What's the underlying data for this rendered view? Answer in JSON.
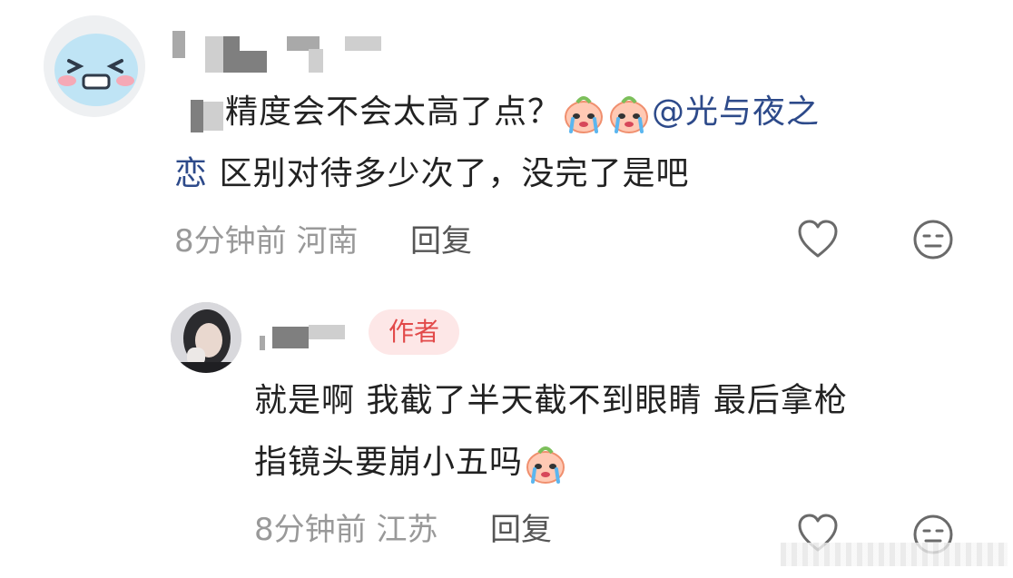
{
  "comment": {
    "text_line1_part1": "精度会不会太高了点？",
    "mention": "@光与夜之",
    "mention_cont": "恋",
    "text_line2": " 区别对待多少次了，没完了是吧",
    "time": "8分钟前",
    "location": "河南",
    "reply_label": "回复"
  },
  "reply": {
    "badge": "作者",
    "text_line1": "就是啊 我截了半天截不到眼睛 最后拿枪",
    "text_line2": "指镜头要崩小五吗",
    "time": "8分钟前",
    "location": "江苏",
    "reply_label": "回复"
  },
  "icons": {
    "like": "heart-outline-icon",
    "dislike": "meh-face-icon",
    "emoji": "crying-face-emoji"
  },
  "colors": {
    "mention": "#2d4a8a",
    "badge_bg": "#fde7e7",
    "badge_text": "#e24a4a",
    "meta": "#999999"
  }
}
